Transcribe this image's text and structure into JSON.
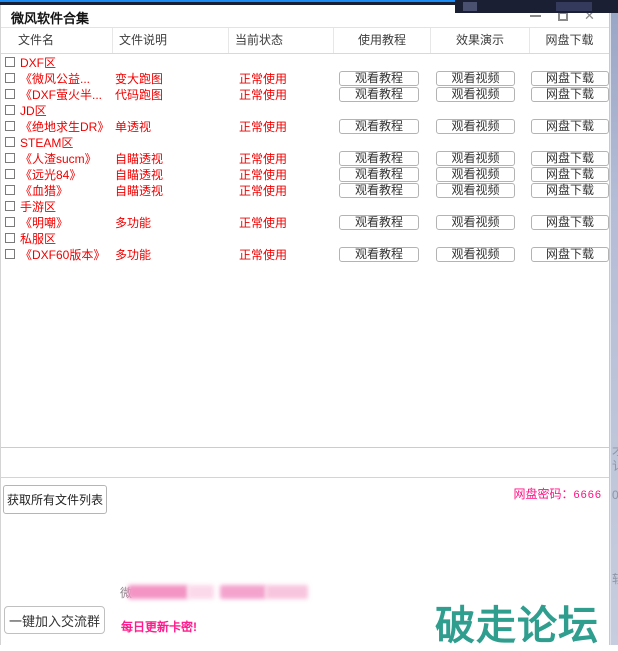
{
  "window": {
    "title": "微风软件合集",
    "controls": {
      "minimize": "minimize",
      "maximize": "maximize",
      "close": "✕"
    }
  },
  "table": {
    "columns": [
      "文件名",
      "文件说明",
      "当前状态",
      "使用教程",
      "效果演示",
      "网盘下载"
    ],
    "buttons": {
      "tutorial": "观看教程",
      "video": "观看视频",
      "download": "网盘下载"
    },
    "rows": [
      {
        "type": "section",
        "name": "DXF区"
      },
      {
        "type": "item",
        "name": "《微风公益...",
        "desc": "变大跑图",
        "status": "正常使用"
      },
      {
        "type": "item",
        "name": "《DXF萤火半...",
        "desc": "代码跑图",
        "status": "正常使用"
      },
      {
        "type": "section",
        "name": "JD区"
      },
      {
        "type": "item",
        "name": "《绝地求生DR》",
        "desc": "单透视",
        "status": "正常使用"
      },
      {
        "type": "section",
        "name": "STEAM区"
      },
      {
        "type": "item",
        "name": "《人渣sucm》",
        "desc": "自瞄透视",
        "status": "正常使用"
      },
      {
        "type": "item",
        "name": "《远光84》",
        "desc": "自瞄透视",
        "status": "正常使用"
      },
      {
        "type": "item",
        "name": "《血猎》",
        "desc": "自瞄透视",
        "status": "正常使用"
      },
      {
        "type": "section",
        "name": "手游区"
      },
      {
        "type": "item",
        "name": "《明嘲》",
        "desc": "多功能",
        "status": "正常使用"
      },
      {
        "type": "section",
        "name": "私服区"
      },
      {
        "type": "item",
        "name": "《DXF60版本》",
        "desc": "多功能",
        "status": "正常使用"
      }
    ]
  },
  "footer": {
    "get_list_button": "获取所有文件列表",
    "pan_password_label": "网盘密码：",
    "pan_password_value": "6666",
    "join_group_button": "一键加入交流群",
    "daily_update_text": "每日更新卡密!",
    "redacted_visible_char": "微"
  },
  "watermark_text": "破走论坛",
  "colors": {
    "row_text_red": "#f20000",
    "pink_accent": "#ff1184",
    "watermark_teal": "#2f9e8f",
    "backdrop_navy": "#1a1f33",
    "backdrop_blue": "#1c8cf5"
  }
}
